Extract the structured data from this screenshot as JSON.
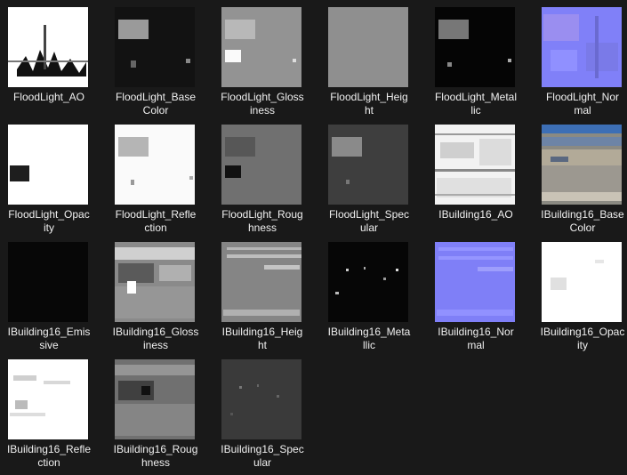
{
  "items": [
    {
      "name": "FloodLight_AO",
      "line1": "FloodLight_AO",
      "line2": "",
      "thumb": "ao-white-mask"
    },
    {
      "name": "FloodLight_BaseColor",
      "line1": "FloodLight_Base",
      "line2": "Color",
      "thumb": "dark-basecolor"
    },
    {
      "name": "FloodLight_Glossiness",
      "line1": "FloodLight_Gloss",
      "line2": "iness",
      "thumb": "gray-gloss"
    },
    {
      "name": "FloodLight_Height",
      "line1": "FloodLight_Heig",
      "line2": "ht",
      "thumb": "flat-gray"
    },
    {
      "name": "FloodLight_Metallic",
      "line1": "FloodLight_Metal",
      "line2": "lic",
      "thumb": "black-metallic"
    },
    {
      "name": "FloodLight_Normal",
      "line1": "FloodLight_Nor",
      "line2": "mal",
      "thumb": "normal-map"
    },
    {
      "name": "FloodLight_Opacity",
      "line1": "FloodLight_Opac",
      "line2": "ity",
      "thumb": "white-opacity"
    },
    {
      "name": "FloodLight_Reflection",
      "line1": "FloodLight_Refle",
      "line2": "ction",
      "thumb": "white-reflection"
    },
    {
      "name": "FloodLight_Roughness",
      "line1": "FloodLight_Roug",
      "line2": "hness",
      "thumb": "gray-roughness"
    },
    {
      "name": "FloodLight_Specular",
      "line1": "FloodLight_Spec",
      "line2": "ular",
      "thumb": "dark-specular"
    },
    {
      "name": "IBuilding16_AO",
      "line1": "IBuilding16_AO",
      "line2": "",
      "thumb": "building-ao"
    },
    {
      "name": "IBuilding16_BaseColor",
      "line1": "IBuilding16_Base",
      "line2": "Color",
      "thumb": "building-color"
    },
    {
      "name": "IBuilding16_Emissive",
      "line1": "IBuilding16_Emis",
      "line2": "sive",
      "thumb": "black-emissive"
    },
    {
      "name": "IBuilding16_Glossiness",
      "line1": "IBuilding16_Gloss",
      "line2": "iness",
      "thumb": "building-gloss"
    },
    {
      "name": "IBuilding16_Height",
      "line1": "IBuilding16_Heig",
      "line2": "ht",
      "thumb": "building-height"
    },
    {
      "name": "IBuilding16_Metallic",
      "line1": "IBuilding16_Meta",
      "line2": "llic",
      "thumb": "building-metallic"
    },
    {
      "name": "IBuilding16_Normal",
      "line1": "IBuilding16_Nor",
      "line2": "mal",
      "thumb": "building-normal"
    },
    {
      "name": "IBuilding16_Opacity",
      "line1": "IBuilding16_Opac",
      "line2": "ity",
      "thumb": "building-opacity"
    },
    {
      "name": "IBuilding16_Reflection",
      "line1": "IBuilding16_Refle",
      "line2": "ction",
      "thumb": "building-reflection"
    },
    {
      "name": "IBuilding16_Roughness",
      "line1": "IBuilding16_Roug",
      "line2": "hness",
      "thumb": "building-roughness"
    },
    {
      "name": "IBuilding16_Specular",
      "line1": "IBuilding16_Spec",
      "line2": "ular",
      "thumb": "building-specular"
    }
  ]
}
